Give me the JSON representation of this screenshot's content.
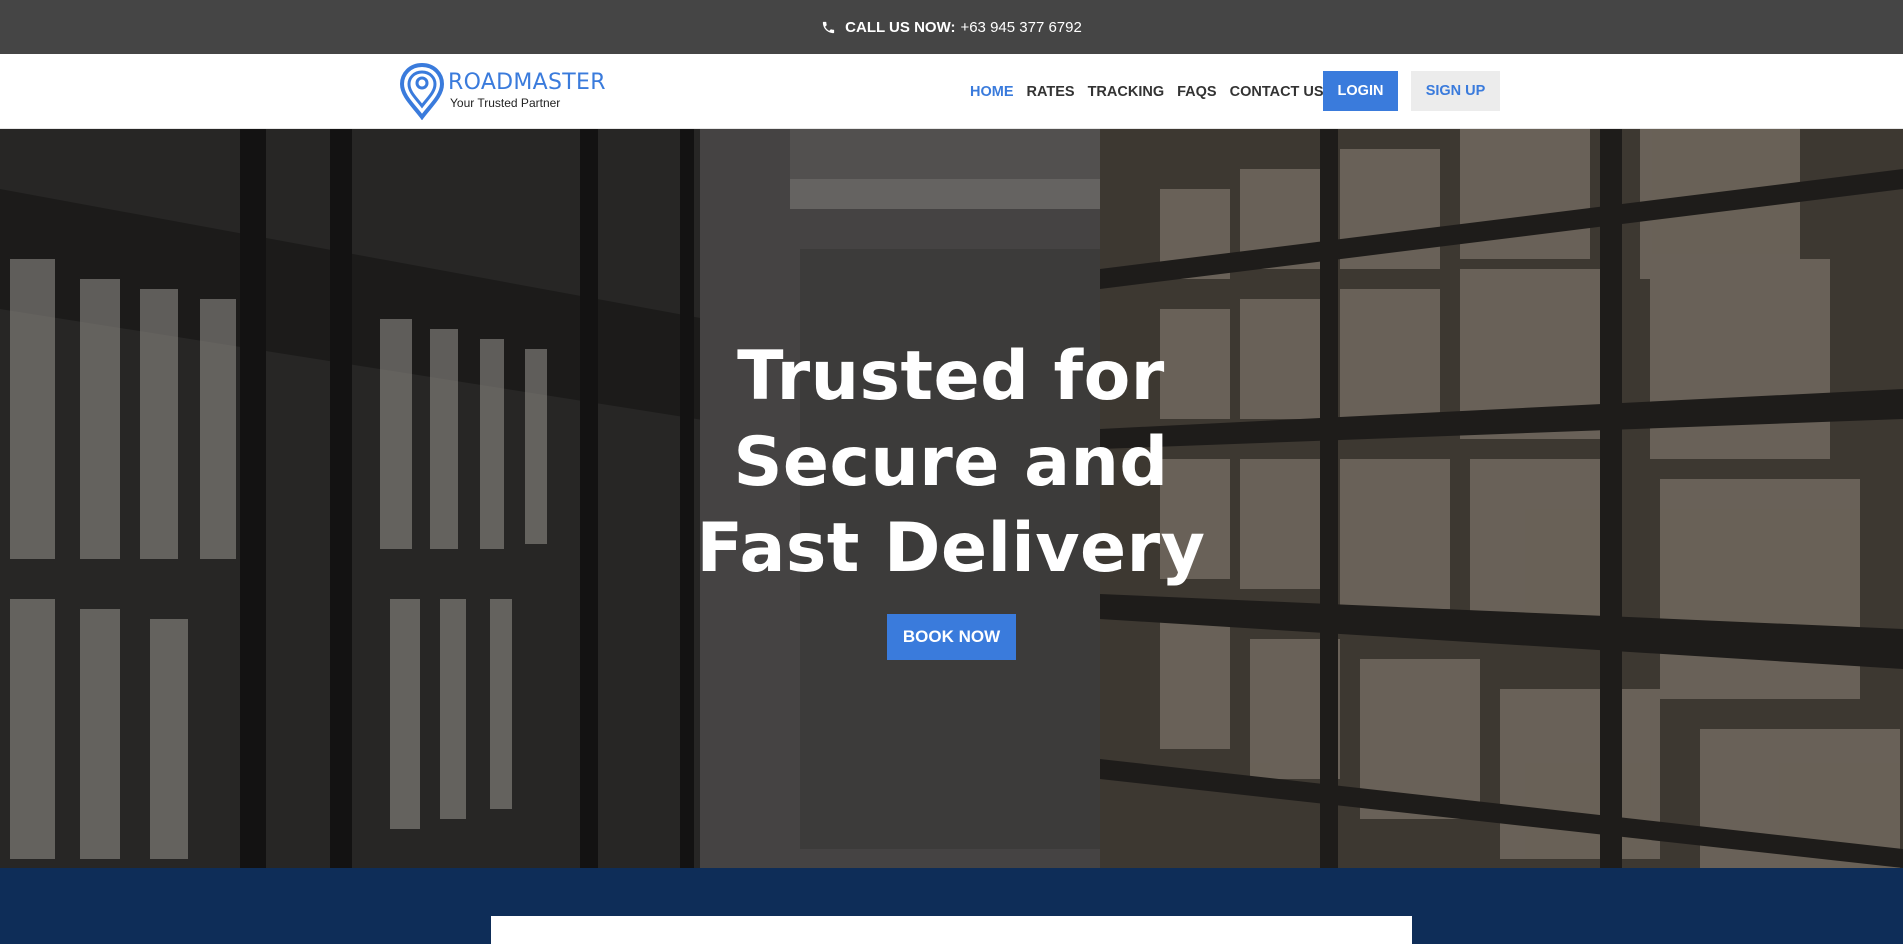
{
  "topbar": {
    "call_label": "CALL US NOW:",
    "phone": "+63 945 377 6792",
    "icon": "phone-icon"
  },
  "header": {
    "brand": "ROADMASTER",
    "tagline": "Your Trusted Partner",
    "logo_icon": "location-pin-icon",
    "nav": [
      {
        "label": "HOME",
        "active": true
      },
      {
        "label": "RATES",
        "active": false
      },
      {
        "label": "TRACKING",
        "active": false
      },
      {
        "label": "FAQS",
        "active": false
      },
      {
        "label": "CONTACT US",
        "active": false
      }
    ],
    "login_label": "LOGIN",
    "signup_label": "SIGN UP"
  },
  "hero": {
    "title_line1": "Trusted for",
    "title_line2": "Secure and",
    "title_line3": "Fast Delivery",
    "cta_label": "BOOK NOW"
  },
  "colors": {
    "accent": "#3a7bdc",
    "topbar_bg": "#454545",
    "band_bg": "#0e2d58"
  }
}
